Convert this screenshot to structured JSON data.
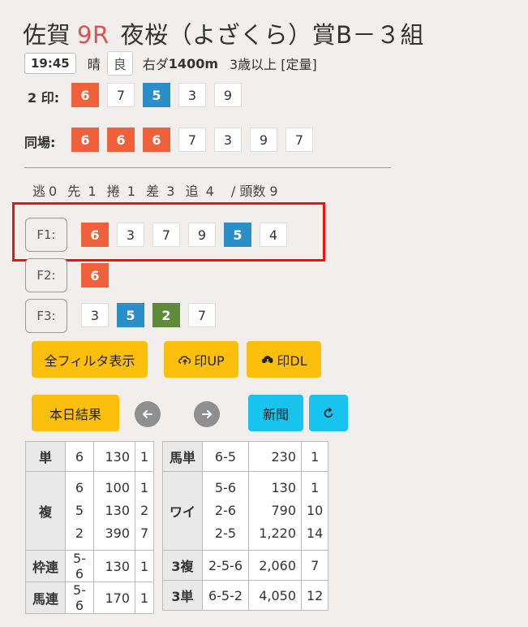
{
  "header": {
    "venue": "佐賀",
    "race_no": "9R",
    "race_name": "夜桜（よざくら）賞B－３組"
  },
  "info": {
    "time": "19:45",
    "weather": "晴",
    "condition": "良",
    "course_prefix": "右ダ",
    "distance": "1400m",
    "age_class": "3歳以上 [定量]"
  },
  "marks": {
    "label": "2 印:",
    "items": [
      {
        "num": "6",
        "color": "red"
      },
      {
        "num": "7",
        "color": "white"
      },
      {
        "num": "5",
        "color": "blue"
      },
      {
        "num": "3",
        "color": "white"
      },
      {
        "num": "9",
        "color": "white"
      }
    ]
  },
  "same_track": {
    "label": "同場:",
    "items": [
      {
        "num": "6",
        "color": "red"
      },
      {
        "num": "6",
        "color": "red"
      },
      {
        "num": "6",
        "color": "red"
      },
      {
        "num": "7",
        "color": "white"
      },
      {
        "num": "3",
        "color": "white"
      },
      {
        "num": "9",
        "color": "white"
      },
      {
        "num": "7",
        "color": "white"
      }
    ]
  },
  "tactics": [
    {
      "label": "逃",
      "count": "0"
    },
    {
      "label": "先",
      "count": "1"
    },
    {
      "label": "捲",
      "count": "1"
    },
    {
      "label": "差",
      "count": "3"
    },
    {
      "label": "追",
      "count": "4"
    }
  ],
  "head_count_text": "/ 頭数 9",
  "filters": [
    {
      "label": "F1:",
      "items": [
        {
          "num": "6",
          "color": "red"
        },
        {
          "num": "3",
          "color": "white"
        },
        {
          "num": "7",
          "color": "white"
        },
        {
          "num": "9",
          "color": "white"
        },
        {
          "num": "5",
          "color": "blue"
        },
        {
          "num": "4",
          "color": "white"
        }
      ]
    },
    {
      "label": "F2:",
      "items": [
        {
          "num": "6",
          "color": "red"
        }
      ]
    },
    {
      "label": "F3:",
      "items": [
        {
          "num": "3",
          "color": "white"
        },
        {
          "num": "5",
          "color": "blue"
        },
        {
          "num": "2",
          "color": "green"
        },
        {
          "num": "7",
          "color": "white"
        }
      ]
    }
  ],
  "buttons": {
    "show_all_filters": "全フィルタ表示",
    "upload_marks": "印UP",
    "download_marks": "印DL",
    "today_results": "本日結果",
    "newspaper": "新聞"
  },
  "payouts_left": {
    "tan": {
      "label": "単",
      "combo": "6",
      "pay": "130",
      "pop": "1"
    },
    "fuku": {
      "label": "複",
      "combos": [
        "6",
        "5",
        "2"
      ],
      "pays": [
        "100",
        "130",
        "390"
      ],
      "pops": [
        "1",
        "2",
        "7"
      ]
    },
    "wakuren": {
      "label": "枠連",
      "combo": "5-6",
      "pay": "130",
      "pop": "1"
    },
    "umaren": {
      "label": "馬連",
      "combo": "5-6",
      "pay": "170",
      "pop": "1"
    }
  },
  "payouts_right": {
    "umatan": {
      "label": "馬単",
      "combo": "6-5",
      "pay": "230",
      "pop": "1"
    },
    "wide": {
      "label": "ワイ",
      "combos": [
        "5-6",
        "2-6",
        "2-5"
      ],
      "pays": [
        "130",
        "790",
        "1,220"
      ],
      "pops": [
        "1",
        "10",
        "14"
      ]
    },
    "sanfuku": {
      "label": "3複",
      "combo": "2-5-6",
      "pay": "2,060",
      "pop": "7"
    },
    "santan": {
      "label": "3単",
      "combo": "6-5-2",
      "pay": "4,050",
      "pop": "12"
    }
  },
  "colors": {
    "red": "#f0603a",
    "blue": "#2a8fc9",
    "green": "#5e8a3a",
    "yellow_button": "#fbbf0c",
    "cyan_button": "#17c4ee",
    "highlight_frame": "#e11111"
  }
}
